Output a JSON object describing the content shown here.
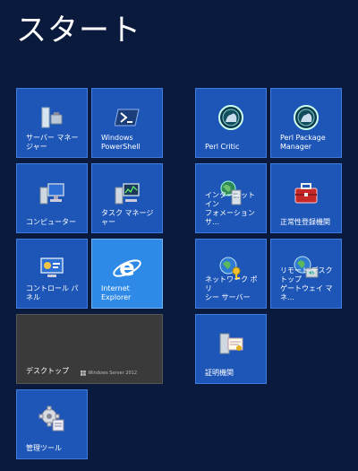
{
  "start": {
    "title": "スタート"
  },
  "tiles": {
    "server_manager": "サーバー マネー\nジャー",
    "powershell": "Windows\nPowerShell",
    "perl_critic": "Perl Critic",
    "perl_package_manager": "Perl Package\nManager",
    "computer": "コンピューター",
    "task_manager": "タスク マネージャー",
    "internet_info": "インターネット イン\nフォメーション サ…",
    "legit_registration": "正常性登録機関",
    "control_panel": "コントロール パネル",
    "internet_explorer": "Internet Explorer",
    "network_policy": "ネットワーク ポリ\nシー サーバー",
    "remote_desktop_gateway": "リモート デスクトップ\nゲートウェイ マネ…",
    "desktop": "デスクトップ",
    "desktop_os": "Windows Server 2012",
    "certificate_authority": "証明機関",
    "admin_tools": "管理ツール"
  },
  "colors": {
    "background": "#0a1a3c",
    "tile": "#1e56b8",
    "tile_ie": "#2e8ae6",
    "tile_desktop": "#3a3a3a"
  },
  "icons": {
    "server_manager": "server-manager-icon",
    "powershell": "powershell-icon",
    "perl_critic": "perl-camel-icon",
    "perl_package_manager": "perl-camel-icon",
    "computer": "computer-icon",
    "task_manager": "task-manager-icon",
    "internet_info": "iis-icon",
    "legit_registration": "toolbox-icon",
    "control_panel": "control-panel-icon",
    "internet_explorer": "ie-icon",
    "network_policy": "network-policy-icon",
    "remote_desktop_gateway": "remote-desktop-gateway-icon",
    "certificate_authority": "certificate-icon",
    "admin_tools": "admin-tools-icon"
  }
}
